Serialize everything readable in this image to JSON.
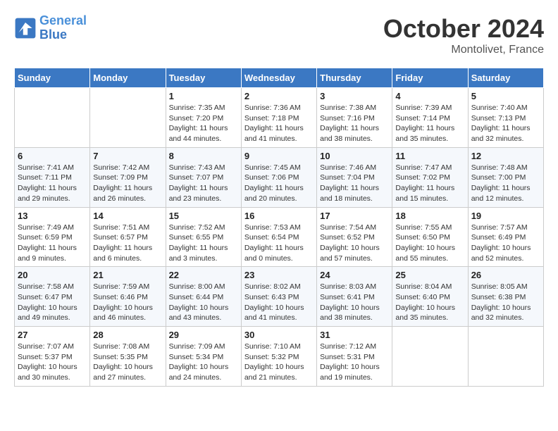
{
  "logo": {
    "line1": "General",
    "line2": "Blue"
  },
  "title": "October 2024",
  "location": "Montolivet, France",
  "days_header": [
    "Sunday",
    "Monday",
    "Tuesday",
    "Wednesday",
    "Thursday",
    "Friday",
    "Saturday"
  ],
  "weeks": [
    [
      {
        "day": "",
        "info": ""
      },
      {
        "day": "",
        "info": ""
      },
      {
        "day": "1",
        "info": "Sunrise: 7:35 AM\nSunset: 7:20 PM\nDaylight: 11 hours\nand 44 minutes."
      },
      {
        "day": "2",
        "info": "Sunrise: 7:36 AM\nSunset: 7:18 PM\nDaylight: 11 hours\nand 41 minutes."
      },
      {
        "day": "3",
        "info": "Sunrise: 7:38 AM\nSunset: 7:16 PM\nDaylight: 11 hours\nand 38 minutes."
      },
      {
        "day": "4",
        "info": "Sunrise: 7:39 AM\nSunset: 7:14 PM\nDaylight: 11 hours\nand 35 minutes."
      },
      {
        "day": "5",
        "info": "Sunrise: 7:40 AM\nSunset: 7:13 PM\nDaylight: 11 hours\nand 32 minutes."
      }
    ],
    [
      {
        "day": "6",
        "info": "Sunrise: 7:41 AM\nSunset: 7:11 PM\nDaylight: 11 hours\nand 29 minutes."
      },
      {
        "day": "7",
        "info": "Sunrise: 7:42 AM\nSunset: 7:09 PM\nDaylight: 11 hours\nand 26 minutes."
      },
      {
        "day": "8",
        "info": "Sunrise: 7:43 AM\nSunset: 7:07 PM\nDaylight: 11 hours\nand 23 minutes."
      },
      {
        "day": "9",
        "info": "Sunrise: 7:45 AM\nSunset: 7:06 PM\nDaylight: 11 hours\nand 20 minutes."
      },
      {
        "day": "10",
        "info": "Sunrise: 7:46 AM\nSunset: 7:04 PM\nDaylight: 11 hours\nand 18 minutes."
      },
      {
        "day": "11",
        "info": "Sunrise: 7:47 AM\nSunset: 7:02 PM\nDaylight: 11 hours\nand 15 minutes."
      },
      {
        "day": "12",
        "info": "Sunrise: 7:48 AM\nSunset: 7:00 PM\nDaylight: 11 hours\nand 12 minutes."
      }
    ],
    [
      {
        "day": "13",
        "info": "Sunrise: 7:49 AM\nSunset: 6:59 PM\nDaylight: 11 hours\nand 9 minutes."
      },
      {
        "day": "14",
        "info": "Sunrise: 7:51 AM\nSunset: 6:57 PM\nDaylight: 11 hours\nand 6 minutes."
      },
      {
        "day": "15",
        "info": "Sunrise: 7:52 AM\nSunset: 6:55 PM\nDaylight: 11 hours\nand 3 minutes."
      },
      {
        "day": "16",
        "info": "Sunrise: 7:53 AM\nSunset: 6:54 PM\nDaylight: 11 hours\nand 0 minutes."
      },
      {
        "day": "17",
        "info": "Sunrise: 7:54 AM\nSunset: 6:52 PM\nDaylight: 10 hours\nand 57 minutes."
      },
      {
        "day": "18",
        "info": "Sunrise: 7:55 AM\nSunset: 6:50 PM\nDaylight: 10 hours\nand 55 minutes."
      },
      {
        "day": "19",
        "info": "Sunrise: 7:57 AM\nSunset: 6:49 PM\nDaylight: 10 hours\nand 52 minutes."
      }
    ],
    [
      {
        "day": "20",
        "info": "Sunrise: 7:58 AM\nSunset: 6:47 PM\nDaylight: 10 hours\nand 49 minutes."
      },
      {
        "day": "21",
        "info": "Sunrise: 7:59 AM\nSunset: 6:46 PM\nDaylight: 10 hours\nand 46 minutes."
      },
      {
        "day": "22",
        "info": "Sunrise: 8:00 AM\nSunset: 6:44 PM\nDaylight: 10 hours\nand 43 minutes."
      },
      {
        "day": "23",
        "info": "Sunrise: 8:02 AM\nSunset: 6:43 PM\nDaylight: 10 hours\nand 41 minutes."
      },
      {
        "day": "24",
        "info": "Sunrise: 8:03 AM\nSunset: 6:41 PM\nDaylight: 10 hours\nand 38 minutes."
      },
      {
        "day": "25",
        "info": "Sunrise: 8:04 AM\nSunset: 6:40 PM\nDaylight: 10 hours\nand 35 minutes."
      },
      {
        "day": "26",
        "info": "Sunrise: 8:05 AM\nSunset: 6:38 PM\nDaylight: 10 hours\nand 32 minutes."
      }
    ],
    [
      {
        "day": "27",
        "info": "Sunrise: 7:07 AM\nSunset: 5:37 PM\nDaylight: 10 hours\nand 30 minutes."
      },
      {
        "day": "28",
        "info": "Sunrise: 7:08 AM\nSunset: 5:35 PM\nDaylight: 10 hours\nand 27 minutes."
      },
      {
        "day": "29",
        "info": "Sunrise: 7:09 AM\nSunset: 5:34 PM\nDaylight: 10 hours\nand 24 minutes."
      },
      {
        "day": "30",
        "info": "Sunrise: 7:10 AM\nSunset: 5:32 PM\nDaylight: 10 hours\nand 21 minutes."
      },
      {
        "day": "31",
        "info": "Sunrise: 7:12 AM\nSunset: 5:31 PM\nDaylight: 10 hours\nand 19 minutes."
      },
      {
        "day": "",
        "info": ""
      },
      {
        "day": "",
        "info": ""
      }
    ]
  ]
}
